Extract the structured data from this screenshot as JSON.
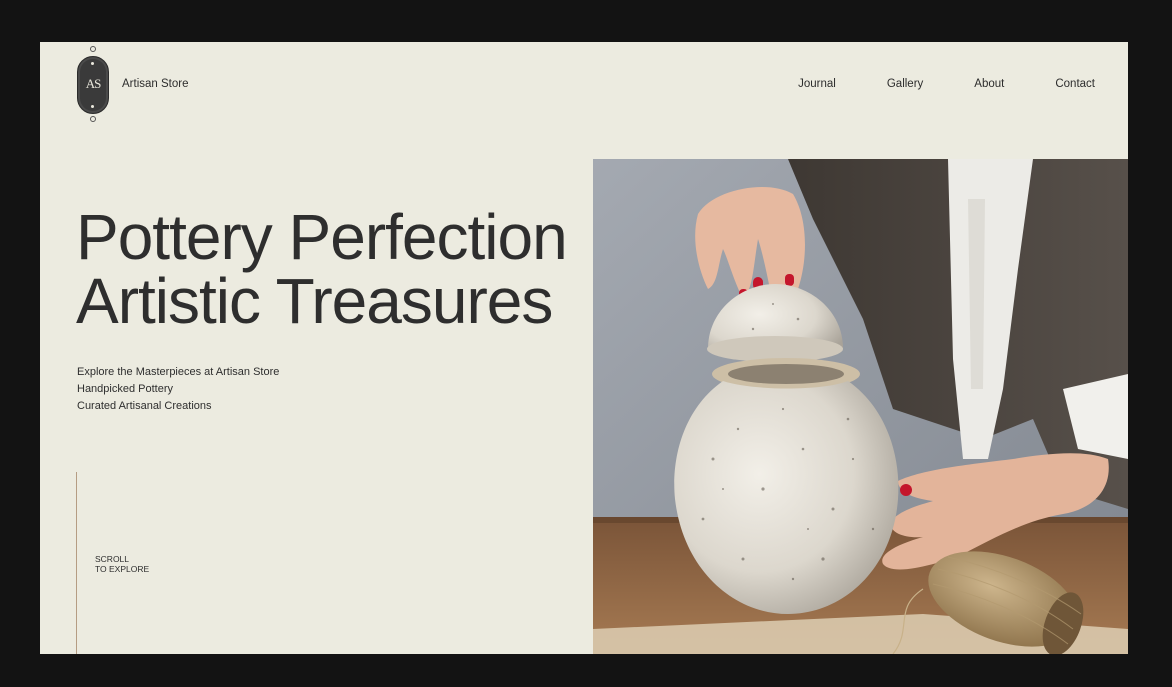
{
  "header": {
    "logo_mark": "AS",
    "brand_name": "Artisan Store",
    "nav": [
      "Journal",
      "Gallery",
      "About",
      "Contact"
    ]
  },
  "hero": {
    "title_line1": "Pottery Perfection",
    "title_line2": "Artistic Treasures",
    "subtext": [
      "Explore the Masterpieces at Artisan Store",
      "Handpicked Pottery",
      "Curated Artisanal Creations"
    ],
    "image_alt": "hands lifting the lid of a speckled ceramic jar next to a spool of twine",
    "scroll_label": [
      "SCROLL",
      "TO EXPLORE"
    ]
  },
  "colors": {
    "page_bg": "#131313",
    "panel_bg": "#ecebe0",
    "text": "#2e2e2e",
    "accent_line": "#b59c83",
    "logo_badge": "#3a3a3a"
  }
}
